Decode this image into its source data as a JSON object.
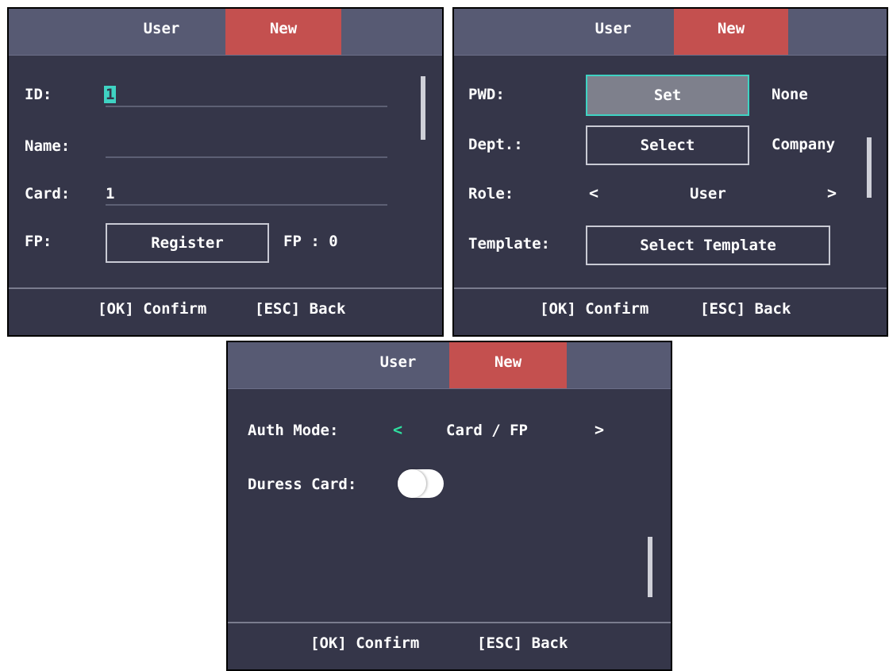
{
  "tabs": {
    "user": "User",
    "new": "New"
  },
  "footer": {
    "confirm": "[OK] Confirm",
    "back": "[ESC] Back"
  },
  "screen1": {
    "id_label": "ID:",
    "id_value": "1",
    "name_label": "Name:",
    "name_value": "",
    "card_label": "Card:",
    "card_value": "1",
    "fp_label": "FP:",
    "fp_button": "Register",
    "fp_count": "FP : 0"
  },
  "screen2": {
    "pwd_label": "PWD:",
    "pwd_button": "Set",
    "pwd_status": "None",
    "dept_label": "Dept.:",
    "dept_button": "Select",
    "dept_value": "Company",
    "role_label": "Role:",
    "role_value": "User",
    "role_prev": "<",
    "role_next": ">",
    "template_label": "Template:",
    "template_button": "Select Template"
  },
  "screen3": {
    "auth_label": "Auth Mode:",
    "auth_value": "Card / FP",
    "auth_prev": "<",
    "auth_next": ">",
    "duress_label": "Duress Card:",
    "duress_on": false
  },
  "colors": {
    "background": "#353649",
    "topbar": "#575a73",
    "active_tab": "#c4504f",
    "accent": "#3fd3c3",
    "arrow_active": "#2fe0a0"
  }
}
